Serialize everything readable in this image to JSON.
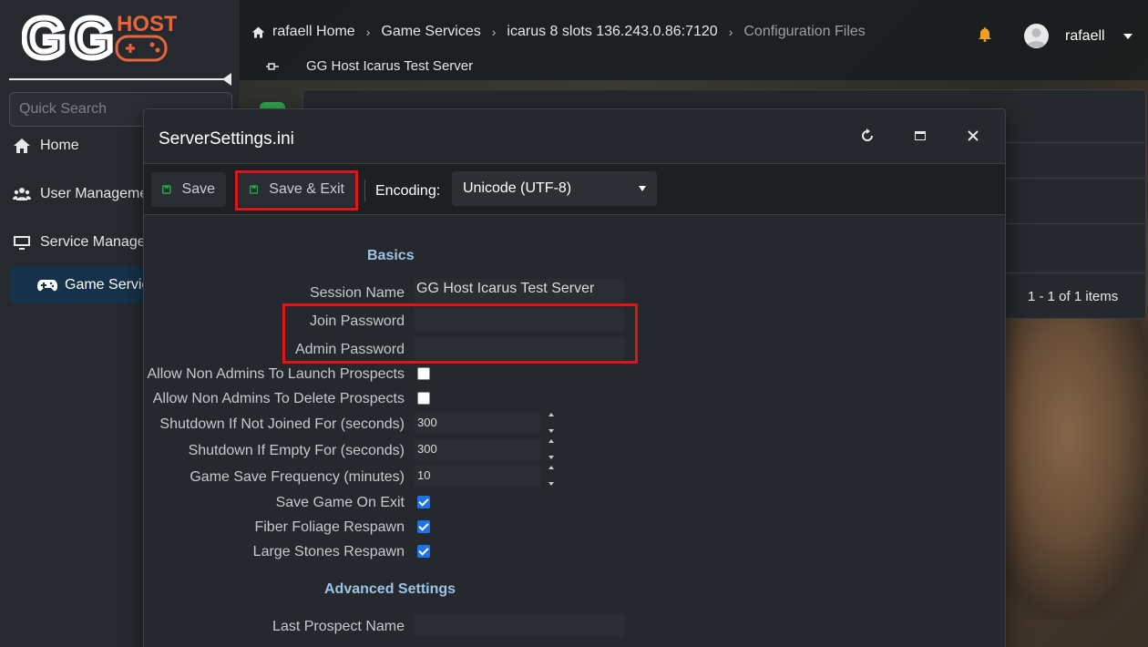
{
  "brand": {
    "logo_text": "GG",
    "logo_sub": "HOST"
  },
  "sidebar": {
    "search_placeholder": "Quick Search",
    "items": [
      {
        "label": "Home",
        "icon": "home-icon"
      },
      {
        "label": "User Manageme",
        "icon": "users-icon"
      },
      {
        "label": "Service Manager",
        "icon": "monitor-icon"
      }
    ],
    "sub_item": {
      "label": "Game Servic",
      "icon": "gamepad-icon"
    }
  },
  "header": {
    "breadcrumb": [
      "rafaell Home",
      "Game Services",
      "icarus 8 slots 136.243.0.86:7120",
      "Configuration Files"
    ],
    "subtitle": "GG Host Icarus Test Server",
    "username": "rafaell"
  },
  "background_panel": {
    "pager_text": "1 - 1 of 1 items"
  },
  "modal": {
    "title": "ServerSettings.ini",
    "toolbar": {
      "save_label": "Save",
      "save_exit_label": "Save & Exit",
      "encoding_label": "Encoding:",
      "encoding_value": "Unicode (UTF-8)"
    },
    "sections": {
      "basics": "Basics",
      "advanced": "Advanced Settings"
    },
    "fields": {
      "session_name": {
        "label": "Session Name",
        "value": "GG Host Icarus Test Server"
      },
      "join_password": {
        "label": "Join Password",
        "value": ""
      },
      "admin_password": {
        "label": "Admin Password",
        "value": ""
      },
      "allow_launch": {
        "label": "Allow Non Admins To Launch Prospects",
        "checked": false
      },
      "allow_delete": {
        "label": "Allow Non Admins To Delete Prospects",
        "checked": false
      },
      "shutdown_not_joined": {
        "label": "Shutdown If Not Joined For (seconds)",
        "value": "300"
      },
      "shutdown_empty": {
        "label": "Shutdown If Empty For (seconds)",
        "value": "300"
      },
      "save_frequency": {
        "label": "Game Save Frequency (minutes)",
        "value": "10"
      },
      "save_on_exit": {
        "label": "Save Game On Exit",
        "checked": true
      },
      "fiber_respawn": {
        "label": "Fiber Foliage Respawn",
        "checked": true
      },
      "stones_respawn": {
        "label": "Large Stones Respawn",
        "checked": true
      },
      "last_prospect": {
        "label": "Last Prospect Name",
        "value": ""
      }
    }
  },
  "colors": {
    "highlight": "#e0141b",
    "section_heading": "#9dc3e6",
    "checkbox_on": "#1e73e8",
    "nav_active": "#16324a"
  }
}
